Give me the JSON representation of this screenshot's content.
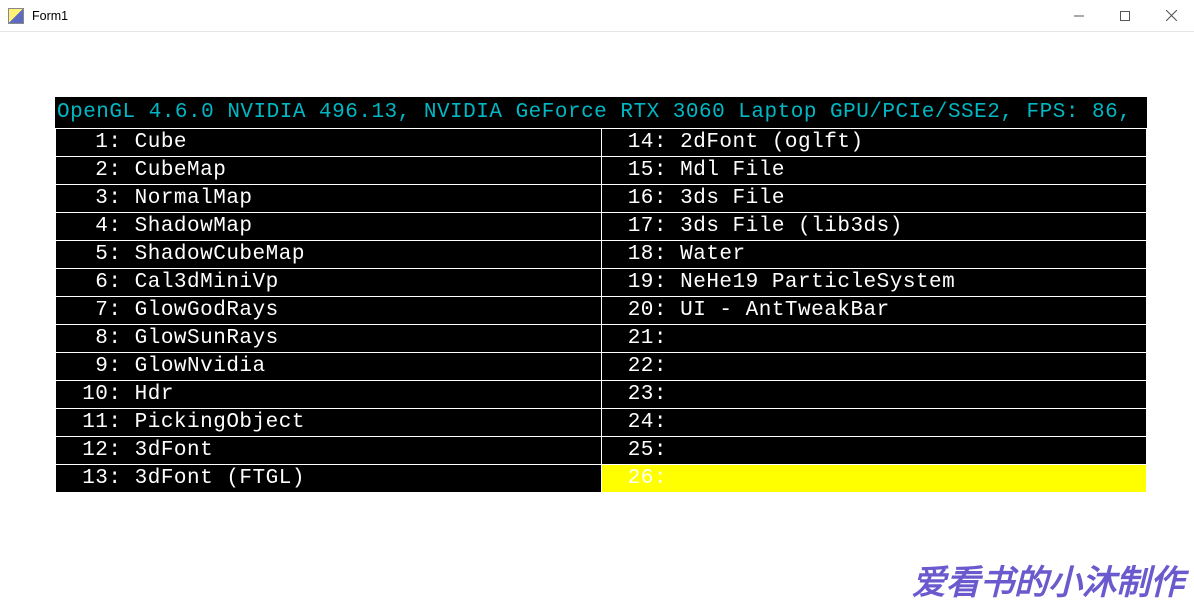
{
  "window": {
    "title": "Form1"
  },
  "console": {
    "header": "OpenGL 4.6.0 NVIDIA 496.13, NVIDIA GeForce RTX 3060 Laptop GPU/PCIe/SSE2, FPS: 86,",
    "left": [
      {
        "n": "1",
        "label": "Cube"
      },
      {
        "n": "2",
        "label": "CubeMap"
      },
      {
        "n": "3",
        "label": "NormalMap"
      },
      {
        "n": "4",
        "label": "ShadowMap"
      },
      {
        "n": "5",
        "label": "ShadowCubeMap"
      },
      {
        "n": "6",
        "label": "Cal3dMiniVp"
      },
      {
        "n": "7",
        "label": "GlowGodRays"
      },
      {
        "n": "8",
        "label": "GlowSunRays"
      },
      {
        "n": "9",
        "label": "GlowNvidia"
      },
      {
        "n": "10",
        "label": "Hdr"
      },
      {
        "n": "11",
        "label": "PickingObject"
      },
      {
        "n": "12",
        "label": "3dFont"
      },
      {
        "n": "13",
        "label": "3dFont (FTGL)"
      }
    ],
    "right": [
      {
        "n": "14",
        "label": "2dFont (oglft)"
      },
      {
        "n": "15",
        "label": "Mdl File"
      },
      {
        "n": "16",
        "label": "3ds File"
      },
      {
        "n": "17",
        "label": "3ds File (lib3ds)"
      },
      {
        "n": "18",
        "label": "Water"
      },
      {
        "n": "19",
        "label": "NeHe19 ParticleSystem"
      },
      {
        "n": "20",
        "label": "UI - AntTweakBar"
      },
      {
        "n": "21",
        "label": ""
      },
      {
        "n": "22",
        "label": ""
      },
      {
        "n": "23",
        "label": ""
      },
      {
        "n": "24",
        "label": ""
      },
      {
        "n": "25",
        "label": ""
      },
      {
        "n": "26",
        "label": "",
        "selected": true
      }
    ]
  },
  "watermark": "爱看书的小沐制作"
}
